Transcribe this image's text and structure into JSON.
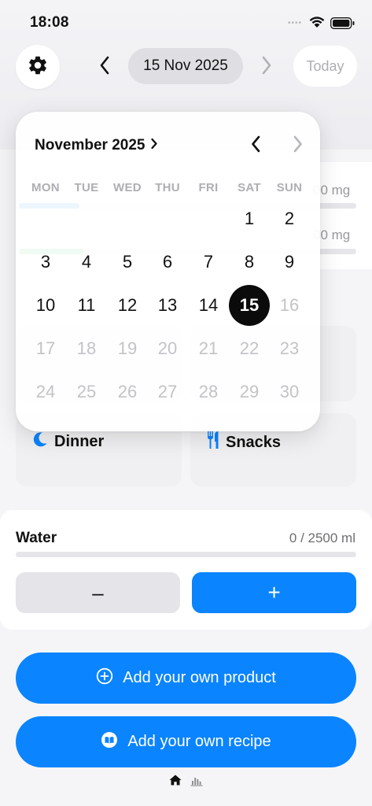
{
  "status_bar": {
    "time": "18:08",
    "signal_dots": "••••"
  },
  "header": {
    "date_label": "15 Nov 2025",
    "today_label": "Today",
    "settings_icon": "gear-icon",
    "prev_icon": "chevron-left-icon",
    "next_icon": "chevron-right-icon"
  },
  "nutrients_card": {
    "rows": [
      {
        "label": "",
        "value": "00 mg",
        "fill": 0.18,
        "color": "#0a84ff"
      },
      {
        "label": "",
        "value": "00 mg",
        "fill": 0.19,
        "color": "#34c759"
      }
    ]
  },
  "meals": {
    "dinner_label": "Dinner",
    "dinner_icon": "moon-icon",
    "snacks_label": "Snacks",
    "snacks_icon": "fork-knife-icon"
  },
  "water": {
    "title": "Water",
    "value": "0 / 2500 ml",
    "progress": 0,
    "minus_label": "–",
    "plus_label": "+"
  },
  "actions": {
    "add_product_label": "Add your own product",
    "add_product_icon": "plus-circle-icon",
    "add_recipe_label": "Add your own recipe",
    "add_recipe_icon": "book-icon"
  },
  "tab_bar": {
    "home_icon": "house-icon",
    "stats_icon": "chart-bars-icon"
  },
  "calendar": {
    "month_label": "November 2025",
    "weekdays": [
      "MON",
      "TUE",
      "WED",
      "THU",
      "FRI",
      "SAT",
      "SUN"
    ],
    "weeks": [
      [
        null,
        null,
        null,
        null,
        null,
        1,
        2
      ],
      [
        3,
        4,
        5,
        6,
        7,
        8,
        9
      ],
      [
        10,
        11,
        12,
        13,
        14,
        15,
        16
      ],
      [
        17,
        18,
        19,
        20,
        21,
        22,
        23
      ],
      [
        24,
        25,
        26,
        27,
        28,
        29,
        30
      ]
    ],
    "selected_day": 15,
    "last_enabled_day": 15
  },
  "colors": {
    "accent": "#0a84ff",
    "selected_day_bg": "#0b0b0b",
    "muted_text": "#c3c3c8"
  }
}
